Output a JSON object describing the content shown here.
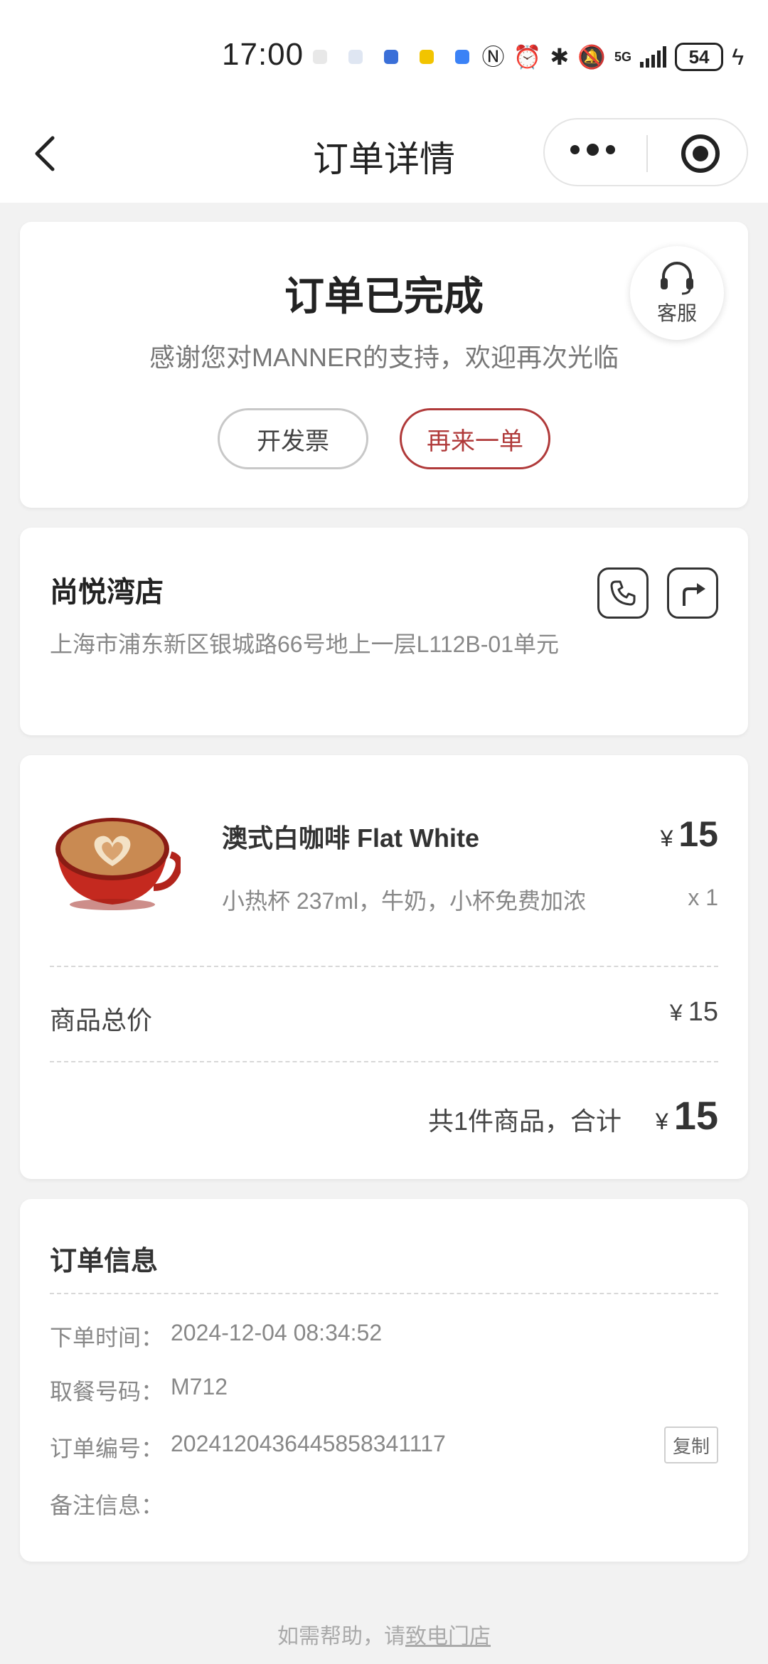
{
  "status_bar": {
    "time": "17:00",
    "network": "5G",
    "battery": "54",
    "icons": [
      "nfc-icon",
      "alarm-icon",
      "bluetooth-icon",
      "mute-icon",
      "signal-icon",
      "battery-icon",
      "charging-icon"
    ]
  },
  "nav": {
    "title": "订单详情",
    "back_icon": "chevron-left-icon",
    "more_icon": "more-dots-icon",
    "close_icon": "target-icon"
  },
  "status_card": {
    "title": "订单已完成",
    "subtitle": "感谢您对MANNER的支持，欢迎再次光临",
    "invoice_label": "开发票",
    "reorder_label": "再来一单",
    "customer_service_label": "客服",
    "accent_color": "#b03a3a"
  },
  "store": {
    "name": "尚悦湾店",
    "address": "上海市浦东新区银城路66号地上一层L112B-01单元"
  },
  "product": {
    "name": "澳式白咖啡 Flat White",
    "currency": "¥",
    "price": "15",
    "spec": "小热杯 237ml，牛奶，小杯免费加浓",
    "qty": "x 1",
    "subtotal_label": "商品总价",
    "subtotal_value": "15",
    "total_label": "共1件商品，合计",
    "total_value": "15"
  },
  "order_info": {
    "title": "订单信息",
    "rows": [
      {
        "key": "下单时间：",
        "value": "2024-12-04 08:34:52"
      },
      {
        "key": "取餐号码：",
        "value": "M712"
      },
      {
        "key": "订单编号：",
        "value": "2024120436445858341117"
      },
      {
        "key": "备注信息：",
        "value": ""
      }
    ],
    "copy_label": "复制"
  },
  "footer": {
    "help_prefix": "如需帮助，请",
    "help_link": "致电门店"
  }
}
